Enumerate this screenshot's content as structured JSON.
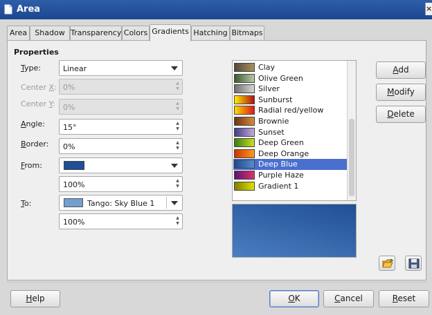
{
  "window": {
    "title": "Area"
  },
  "tabs": [
    {
      "label": "Area",
      "active": false
    },
    {
      "label": "Shadow",
      "active": false
    },
    {
      "label": "Transparency",
      "active": false
    },
    {
      "label": "Colors",
      "active": false
    },
    {
      "label": "Gradients",
      "active": true
    },
    {
      "label": "Hatching",
      "active": false
    },
    {
      "label": "Bitmaps",
      "active": false
    }
  ],
  "properties": {
    "section_title": "Properties",
    "type": {
      "label_u": "T",
      "label_rest": "ype:",
      "value": "Linear"
    },
    "center_x": {
      "label_pre": "Center ",
      "label_u": "X",
      "label_post": ":",
      "value": "0%",
      "enabled": false
    },
    "center_y": {
      "label_pre": "Center ",
      "label_u": "Y",
      "label_post": ":",
      "value": "0%",
      "enabled": false
    },
    "angle": {
      "label_u": "A",
      "label_rest": "ngle:",
      "value": "15°"
    },
    "border": {
      "label_u": "B",
      "label_rest": "order:",
      "value": "0%"
    },
    "from": {
      "label_u": "F",
      "label_rest": "rom:",
      "color": "#1f4f96",
      "intensity": "100%"
    },
    "to": {
      "label_u": "T",
      "label_rest": "o:",
      "color": "#729fcf",
      "color_name": "Tango: Sky Blue 1",
      "intensity": "100%"
    }
  },
  "gradient_list": [
    {
      "name": "Clay",
      "c1": "#4f4a3a",
      "c2": "#a8905a",
      "selected": false
    },
    {
      "name": "Olive Green",
      "c1": "#3c5a33",
      "c2": "#b6c8a4",
      "selected": false
    },
    {
      "name": "Silver",
      "c1": "#707070",
      "c2": "#d6d6d6",
      "selected": false
    },
    {
      "name": "Sunburst",
      "c1": "#ffee00",
      "c2": "#b01010",
      "selected": false
    },
    {
      "name": "Radial red/yellow",
      "c1": "#ffdd00",
      "c2": "#dd1818",
      "selected": false
    },
    {
      "name": "Brownie",
      "c1": "#6b3414",
      "c2": "#d98a3a",
      "selected": false
    },
    {
      "name": "Sunset",
      "c1": "#3e3f86",
      "c2": "#c8a8d8",
      "selected": false
    },
    {
      "name": "Deep Green",
      "c1": "#3c7c12",
      "c2": "#c8e020",
      "selected": false
    },
    {
      "name": "Deep Orange",
      "c1": "#cc3300",
      "c2": "#ff9922",
      "selected": false
    },
    {
      "name": "Deep Blue",
      "c1": "#1c4a90",
      "c2": "#5a8ad0",
      "selected": true
    },
    {
      "name": "Purple Haze",
      "c1": "#5a1670",
      "c2": "#e0306a",
      "selected": false
    },
    {
      "name": "Gradient 1",
      "c1": "#7f7f00",
      "c2": "#e0e000",
      "selected": false
    }
  ],
  "side_buttons": {
    "add": {
      "u": "A",
      "rest": "dd"
    },
    "modify": {
      "u": "M",
      "rest": "odify"
    },
    "delete": {
      "u": "D",
      "rest": "elete"
    }
  },
  "icons": {
    "load": "open-folder-icon",
    "save": "floppy-disk-icon"
  },
  "footer": {
    "help": {
      "u": "H",
      "rest": "elp"
    },
    "ok": {
      "u": "O",
      "rest": "K"
    },
    "cancel": {
      "u": "C",
      "rest": "ancel"
    },
    "reset": {
      "u": "R",
      "rest": "eset"
    }
  }
}
